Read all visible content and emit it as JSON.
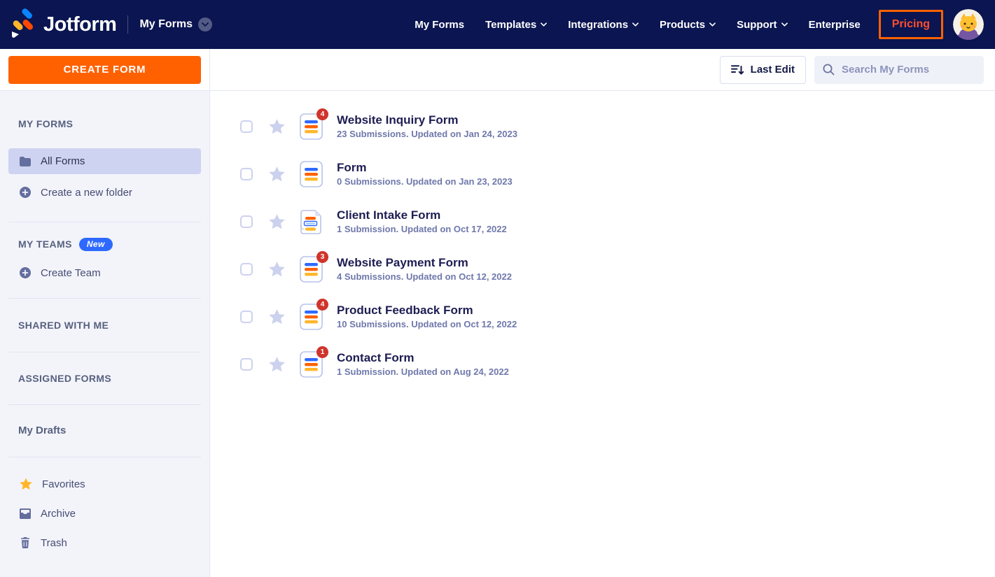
{
  "colors": {
    "navbar_bg": "#0a1551",
    "accent_orange": "#ff6100",
    "badge_red": "#d0342c",
    "bar_blue": "#2e69ff",
    "bar_orange": "#ff6100",
    "bar_yellow": "#ffb629",
    "sidebar_bg": "#f3f4fa",
    "selected_item_bg": "#ced3f1",
    "favorite_star_yellow": "#ffb629"
  },
  "navbar": {
    "brand": "Jotform",
    "context_label": "My Forms",
    "items": [
      {
        "label": "My Forms",
        "chevron": false
      },
      {
        "label": "Templates",
        "chevron": true
      },
      {
        "label": "Integrations",
        "chevron": true
      },
      {
        "label": "Products",
        "chevron": true
      },
      {
        "label": "Support",
        "chevron": true
      },
      {
        "label": "Enterprise",
        "chevron": false
      }
    ],
    "pricing_label": "Pricing"
  },
  "sidebar": {
    "create_form_label": "CREATE FORM",
    "my_forms_header": "MY FORMS",
    "all_forms_label": "All Forms",
    "create_folder_label": "Create a new folder",
    "my_teams_header": "MY TEAMS",
    "new_badge_label": "New",
    "create_team_label": "Create Team",
    "shared_header": "SHARED WITH ME",
    "assigned_header": "ASSIGNED FORMS",
    "my_drafts_label": "My Drafts",
    "favorites_label": "Favorites",
    "archive_label": "Archive",
    "trash_label": "Trash"
  },
  "toolbar": {
    "sort_label": "Last Edit",
    "search_placeholder": "Search My Forms"
  },
  "forms": [
    {
      "title": "Website Inquiry Form",
      "subtitle": "23 Submissions. Updated on Jan 24, 2023",
      "badge": "4",
      "icon": "classic-form"
    },
    {
      "title": "Form",
      "subtitle": "0 Submissions. Updated on Jan 23, 2023",
      "badge": "",
      "icon": "classic-form"
    },
    {
      "title": "Client Intake Form",
      "subtitle": "1 Submission. Updated on Oct 17, 2022",
      "badge": "",
      "icon": "card-form"
    },
    {
      "title": "Website Payment Form",
      "subtitle": "4 Submissions. Updated on Oct 12, 2022",
      "badge": "3",
      "icon": "classic-form"
    },
    {
      "title": "Product Feedback Form",
      "subtitle": "10 Submissions. Updated on Oct 12, 2022",
      "badge": "4",
      "icon": "classic-form"
    },
    {
      "title": "Contact Form",
      "subtitle": "1 Submission. Updated on Aug 24, 2022",
      "badge": "1",
      "icon": "classic-form"
    }
  ]
}
